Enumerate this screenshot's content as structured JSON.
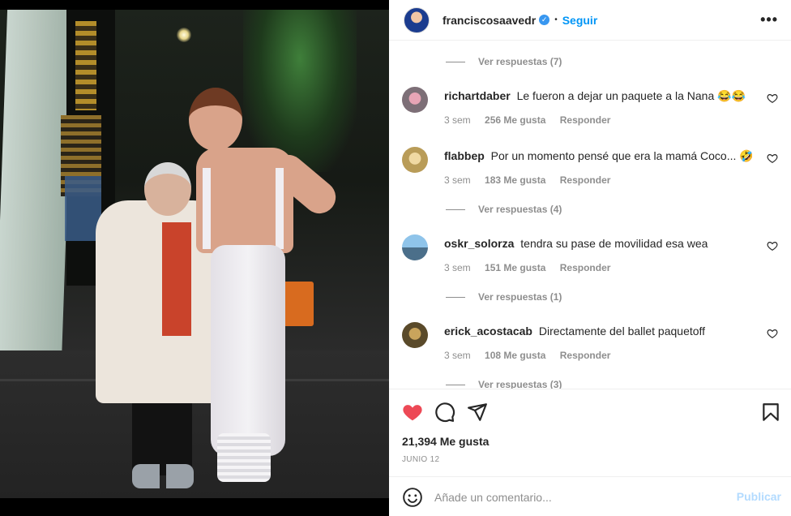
{
  "post": {
    "username": "franciscosaavedr",
    "verified_icon": "check-badge-icon",
    "separator": "•",
    "follow_label": "Seguir",
    "more_icon": "more-horizontal-icon",
    "more_label": "•••"
  },
  "comments": [
    {
      "type": "replies",
      "label": "Ver respuestas (7)"
    },
    {
      "type": "comment",
      "username": "richartdaber",
      "text": "Le fueron a dejar un paquete a la Nana 😂😂",
      "time": "3 sem",
      "likes": "256 Me gusta",
      "reply": "Responder"
    },
    {
      "type": "comment",
      "username": "flabbep",
      "text": "Por un momento pensé que era la mamá Coco... 🤣",
      "time": "3 sem",
      "likes": "183 Me gusta",
      "reply": "Responder"
    },
    {
      "type": "replies",
      "label": "Ver respuestas (4)"
    },
    {
      "type": "comment",
      "username": "oskr_solorza",
      "text": "tendra su pase de movilidad esa wea",
      "time": "3 sem",
      "likes": "151 Me gusta",
      "reply": "Responder"
    },
    {
      "type": "replies",
      "label": "Ver respuestas (1)"
    },
    {
      "type": "comment",
      "username": "erick_acostacab",
      "text": "Directamente del ballet paquetoff",
      "time": "3 sem",
      "likes": "108 Me gusta",
      "reply": "Responder"
    },
    {
      "type": "replies",
      "label": "Ver respuestas (3)"
    }
  ],
  "actions": {
    "like_icon": "heart-filled-icon",
    "comment_icon": "comment-icon",
    "share_icon": "send-icon",
    "save_icon": "bookmark-icon",
    "like_color": "#ed4956"
  },
  "likes_total": "21,394 Me gusta",
  "date": "JUNIO 12",
  "add_comment": {
    "emoji_icon": "emoji-icon",
    "placeholder": "Añade un comentario...",
    "publish_label": "Publicar"
  },
  "colors": {
    "accent": "#0095f6",
    "publish_disabled": "#b3dbff",
    "muted_text": "#8e8e8e"
  }
}
